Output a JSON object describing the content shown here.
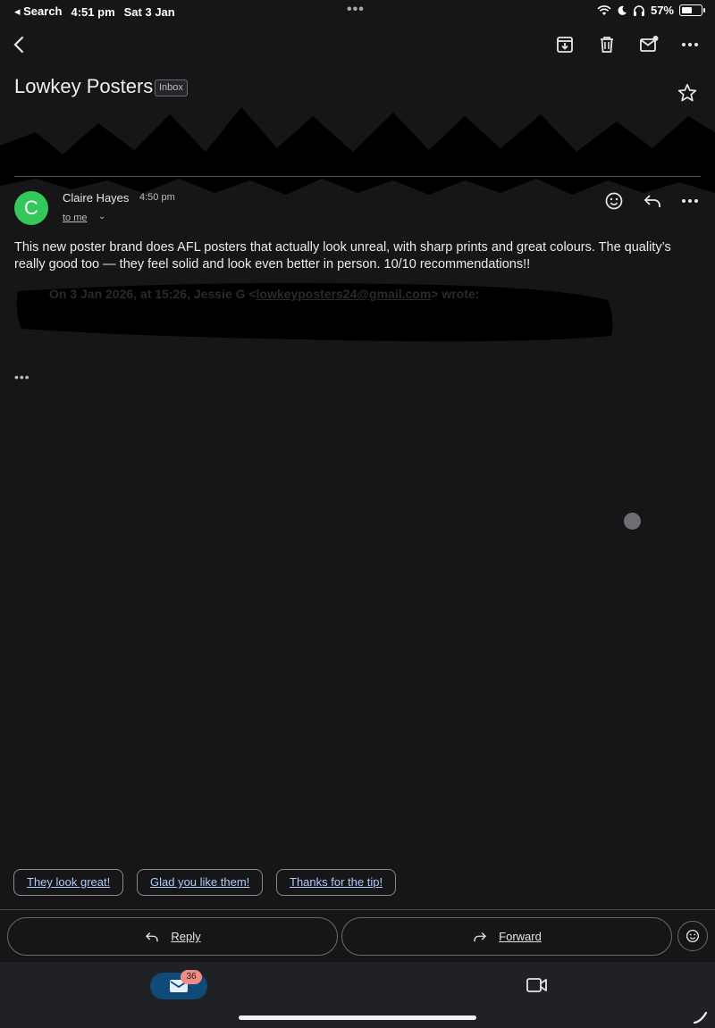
{
  "status_bar": {
    "back_app": "◂ Search",
    "time": "4:51 pm",
    "date": "Sat 3 Jan",
    "multitask": "•••",
    "battery_percent": "57%",
    "battery_level": 0.57,
    "icons": [
      "wifi-icon",
      "moon-icon",
      "headphones-icon",
      "battery-icon"
    ]
  },
  "toolbar": {
    "icons": [
      "back-arrow-icon",
      "archive-icon",
      "delete-icon",
      "mark-unread-icon",
      "more-icon"
    ]
  },
  "thread": {
    "subject": "Lowkey Posters",
    "label": "Inbox",
    "star_icon": "star-outline-icon"
  },
  "message": {
    "avatar_letter": "C",
    "avatar_color": "#34c759",
    "sender": "Claire Hayes",
    "time": "4:50 pm",
    "recipient": "to me",
    "body": "This new poster brand does AFL posters that actually look unreal, with sharp prints and great colours. The quality’s really good too — they feel solid and look even better in person. 10/10 recommendations!!",
    "quote_prefix": "On 3 Jan 2026, at 15:26, Jessie G <",
    "quote_email": "lowkeyposters24@gmail.com",
    "quote_suffix": "> wrote:",
    "show_trimmed": "•••"
  },
  "smart_replies": [
    "They look great!",
    "Glad you like them!",
    "Thanks for the tip!"
  ],
  "actions": {
    "reply": "Reply",
    "forward": "Forward"
  },
  "bottom_nav": {
    "mail_badge": "36",
    "accent": "#0f4a78",
    "badge_color": "#f28b82"
  }
}
